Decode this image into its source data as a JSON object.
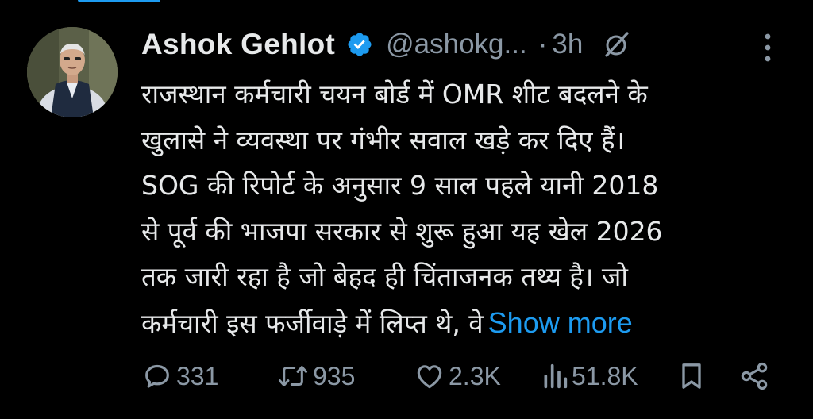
{
  "author": {
    "name": "Ashok Gehlot",
    "handle": "@ashokg...",
    "separator": "·",
    "time": "3h",
    "verified": true
  },
  "tweet": {
    "lines": [
      "राजस्थान कर्मचारी चयन बोर्ड में OMR शीट बदलने के",
      "खुलासे ने व्यवस्था पर गंभीर सवाल खड़े कर दिए हैं।",
      "SOG की रिपोर्ट के अनुसार 9 साल पहले यानी 2018",
      "से पूर्व की भाजपा सरकार से शुरू हुआ यह खेल 2026",
      "तक जारी रहा है जो बेहद ही चिंताजनक तथ्य है। जो",
      "कर्मचारी इस फर्जीवाड़े में लिप्त थे, वे"
    ],
    "show_more": "Show more"
  },
  "actions": {
    "replies": "331",
    "reposts": "935",
    "likes": "2.3K",
    "views": "51.8K"
  },
  "icons": {
    "verified": "verified-badge-icon",
    "grok": "grok-icon",
    "more": "more-vertical-icon",
    "reply": "reply-icon",
    "repost": "repost-icon",
    "like": "heart-icon",
    "views": "views-icon",
    "bookmark": "bookmark-icon",
    "share": "share-icon"
  },
  "colors": {
    "background": "#000000",
    "text": "#e7e9ea",
    "muted": "#8b98a5",
    "accent": "#1d9bf0"
  }
}
